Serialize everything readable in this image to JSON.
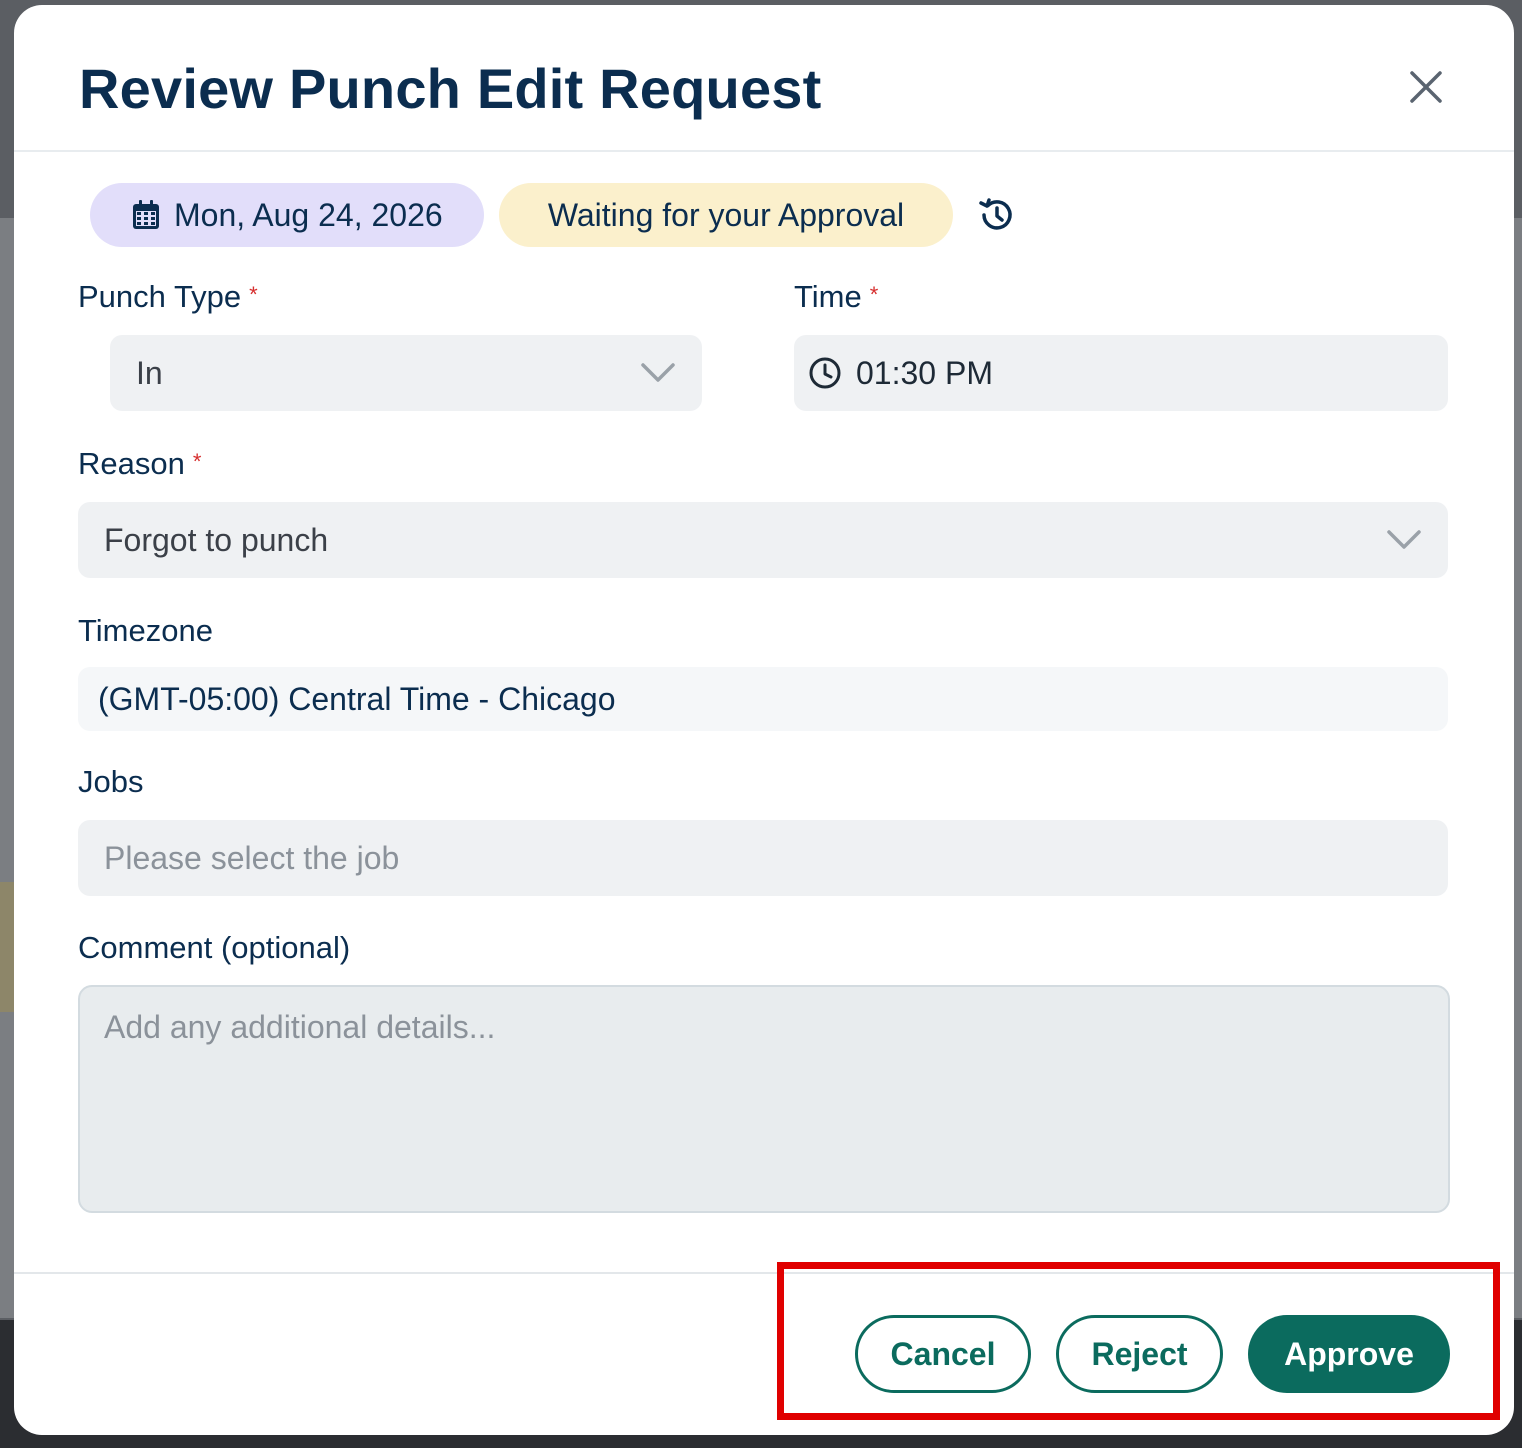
{
  "modal": {
    "title": "Review Punch Edit Request",
    "close_icon": "close-icon"
  },
  "status_bar": {
    "date": "Mon, Aug 24, 2026",
    "date_icon": "calendar-icon",
    "status": "Waiting for your Approval",
    "history_icon": "history-icon",
    "colors": {
      "date_chip": "#e2defa",
      "status_chip": "#fbf0cc"
    }
  },
  "form": {
    "punch_type": {
      "label": "Punch Type",
      "required_mark": "*",
      "value": "In"
    },
    "time": {
      "label": "Time",
      "required_mark": "*",
      "value": "01:30 PM",
      "icon": "clock-icon"
    },
    "reason": {
      "label": "Reason",
      "required_mark": "*",
      "value": "Forgot to punch"
    },
    "timezone": {
      "label": "Timezone",
      "value": "(GMT-05:00) Central Time - Chicago"
    },
    "jobs": {
      "label": "Jobs",
      "placeholder": "Please select the job"
    },
    "comment": {
      "label": "Comment (optional)",
      "placeholder": "Add any additional details..."
    }
  },
  "footer": {
    "cancel_label": "Cancel",
    "reject_label": "Reject",
    "approve_label": "Approve",
    "colors": {
      "primary": "#0b6b5e",
      "highlight": "#e00000"
    }
  }
}
